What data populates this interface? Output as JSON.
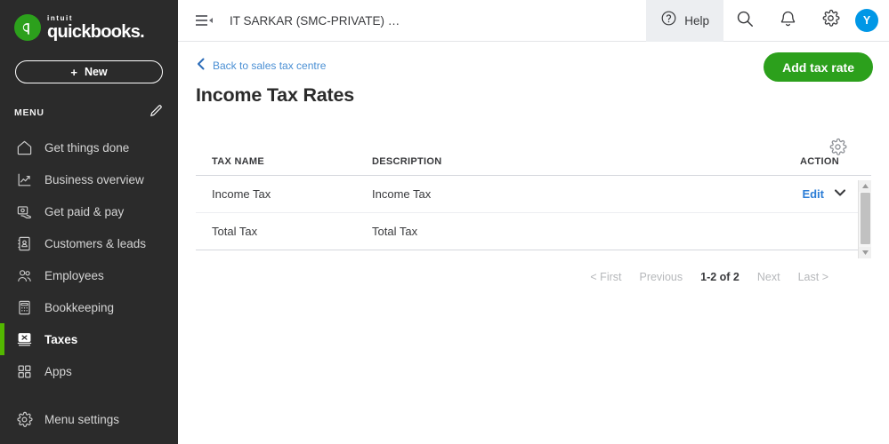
{
  "sidebar": {
    "logo": {
      "intuit": "intuit",
      "product": "quickbooks."
    },
    "new_button": {
      "plus": "+",
      "label": "New"
    },
    "menu_header": "MENU",
    "items": [
      {
        "label": "Get things done",
        "icon": "home-icon",
        "active": false
      },
      {
        "label": "Business overview",
        "icon": "chart-icon",
        "active": false
      },
      {
        "label": "Get paid & pay",
        "icon": "get-paid-icon",
        "active": false
      },
      {
        "label": "Customers & leads",
        "icon": "contacts-icon",
        "active": false
      },
      {
        "label": "Employees",
        "icon": "people-icon",
        "active": false
      },
      {
        "label": "Bookkeeping",
        "icon": "calculator-icon",
        "active": false
      },
      {
        "label": "Taxes",
        "icon": "taxes-icon",
        "active": true
      },
      {
        "label": "Apps",
        "icon": "grid-icon",
        "active": false
      }
    ],
    "settings_item": {
      "label": "Menu settings",
      "icon": "gear-icon"
    }
  },
  "topbar": {
    "company_name": "IT SARKAR (SMC-PRIVATE) …",
    "help_label": "Help",
    "avatar_initial": "Y"
  },
  "page": {
    "back_link": "Back to sales tax centre",
    "title": "Income Tax Rates",
    "add_button": "Add tax rate"
  },
  "table": {
    "columns": [
      "TAX NAME",
      "DESCRIPTION",
      "ACTION"
    ],
    "rows": [
      {
        "tax_name": "Income Tax",
        "description": "Income Tax",
        "action": "Edit",
        "has_action": true
      },
      {
        "tax_name": "Total Tax",
        "description": "Total Tax",
        "action": "",
        "has_action": false
      }
    ]
  },
  "pagination": {
    "first": "< First",
    "previous": "Previous",
    "count": "1-2 of 2",
    "next": "Next",
    "last": "Last >"
  },
  "colors": {
    "brand_green": "#2CA01C",
    "accent_green": "#53B700",
    "sidebar_bg": "#2b2b2b",
    "link_blue": "#2c7dd6",
    "avatar_blue": "#0097E6"
  }
}
